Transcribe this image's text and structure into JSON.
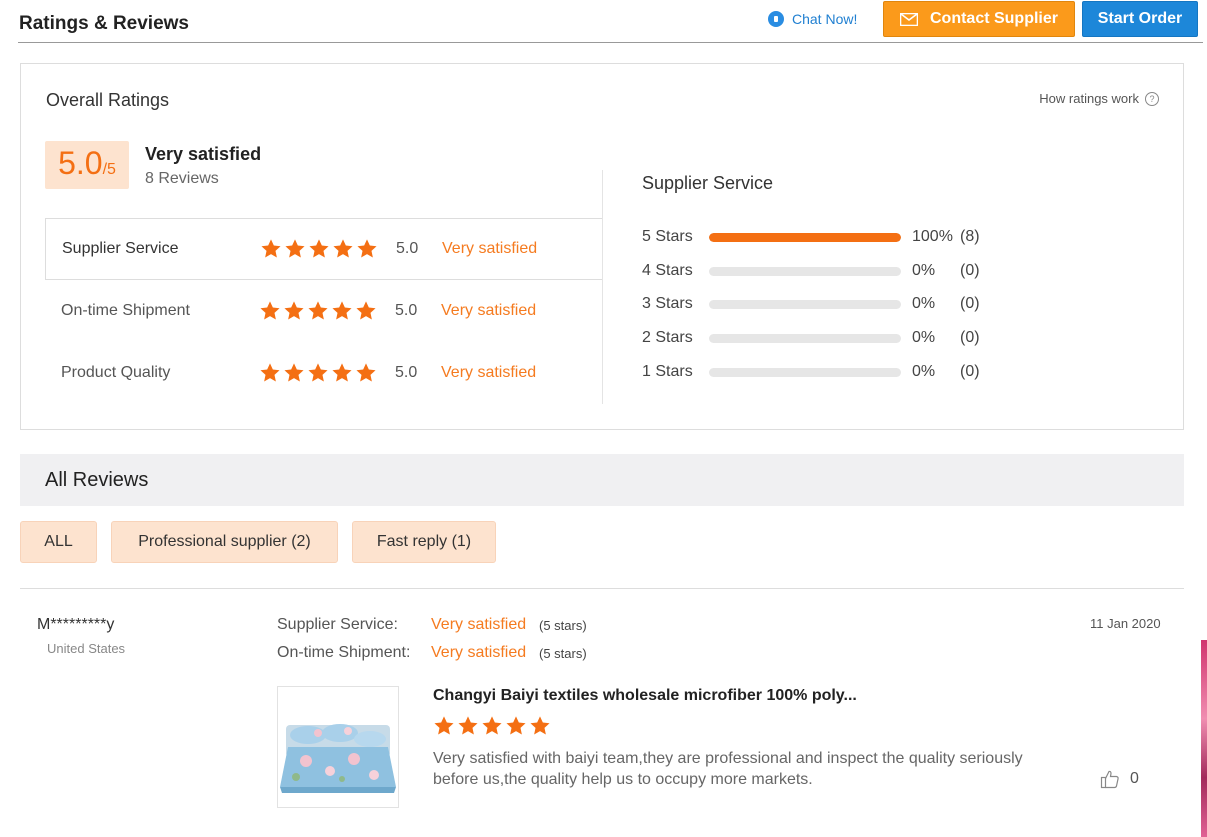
{
  "header": {
    "title": "Ratings & Reviews",
    "chat_label": "Chat Now!",
    "contact_label": "Contact Supplier",
    "start_order_label": "Start Order"
  },
  "overall": {
    "title": "Overall Ratings",
    "how_ratings_label": "How ratings work",
    "help_symbol": "?",
    "score": "5.0",
    "score_max": "/5",
    "score_text": "Very satisfied",
    "review_count": "8 Reviews",
    "categories": [
      {
        "name": "Supplier Service",
        "rating": 5,
        "score": "5.0",
        "label": "Very satisfied"
      },
      {
        "name": "On-time Shipment",
        "rating": 5,
        "score": "5.0",
        "label": "Very satisfied"
      },
      {
        "name": "Product Quality",
        "rating": 5,
        "score": "5.0",
        "label": "Very satisfied"
      }
    ]
  },
  "distribution": {
    "title": "Supplier Service",
    "rows": [
      {
        "label": "5  Stars",
        "fraction": 1.0,
        "percent": "100%",
        "count": "(8)"
      },
      {
        "label": "4  Stars",
        "fraction": 0,
        "percent": "0%",
        "count": "(0)"
      },
      {
        "label": "3  Stars",
        "fraction": 0,
        "percent": "0%",
        "count": "(0)"
      },
      {
        "label": "2  Stars",
        "fraction": 0,
        "percent": "0%",
        "count": "(0)"
      },
      {
        "label": "1  Stars",
        "fraction": 0,
        "percent": "0%",
        "count": "(0)"
      }
    ]
  },
  "reviews_section": {
    "title": "All Reviews",
    "filters": [
      "ALL",
      "Professional supplier (2)",
      "Fast reply (1)"
    ]
  },
  "review": {
    "reviewer": "M*********y",
    "country": "United States",
    "date": "11 Jan 2020",
    "fields": [
      {
        "name": "Supplier Service:",
        "value": "Very satisfied",
        "stars": "(5 stars)"
      },
      {
        "name": "On-time Shipment:",
        "value": "Very satisfied",
        "stars": "(5 stars)"
      }
    ],
    "product_title": "Changyi Baiyi textiles wholesale microfiber 100% poly...",
    "product_rating": 5,
    "text": "Very satisfied with baiyi team,they are professional and inspect the quality seriously before us,the quality help us to occupy more markets.",
    "likes": "0"
  },
  "colors": {
    "accent": "#f46f13",
    "contact_button": "#fb9a1b",
    "start_order_button": "#1d87d9",
    "chip_background": "#fde3cf"
  },
  "icons": [
    "chat-bubble-icon",
    "mail-icon",
    "help-icon",
    "star-icon",
    "thumbs-up-icon",
    "bedding-product-image"
  ]
}
